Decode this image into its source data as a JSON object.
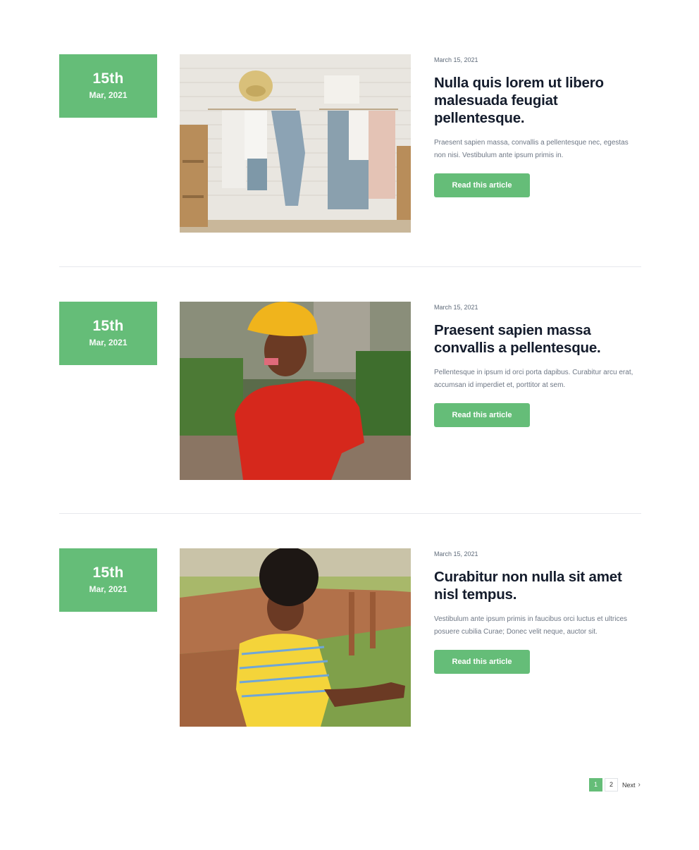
{
  "posts": [
    {
      "date_day": "15th",
      "date_month": "Mar, 2021",
      "meta_date": "March 15, 2021",
      "title": "Nulla quis lorem ut libero malesuada feugiat pellentesque.",
      "excerpt": "Praesent sapien massa, convallis a pellentesque nec, egestas non nisi. Vestibulum ante ipsum primis in.",
      "button_label": "Read this article",
      "image": "clothes-rack-photo"
    },
    {
      "date_day": "15th",
      "date_month": "Mar, 2021",
      "meta_date": "March 15, 2021",
      "title": "Praesent sapien massa convallis a pellentesque.",
      "excerpt": "Pellentesque in ipsum id orci porta dapibus. Curabitur arcu erat, accumsan id imperdiet et, porttitor at sem.",
      "button_label": "Read this article",
      "image": "woman-yellow-beanie-photo"
    },
    {
      "date_day": "15th",
      "date_month": "Mar, 2021",
      "meta_date": "March 15, 2021",
      "title": "Curabitur non nulla sit amet nisl tempus.",
      "excerpt": "Vestibulum ante ipsum primis in faucibus orci luctus et ultrices posuere cubilia Curae; Donec velit neque, auctor sit.",
      "button_label": "Read this article",
      "image": "woman-striped-shirt-photo"
    }
  ],
  "pagination": {
    "pages": [
      "1",
      "2"
    ],
    "current": "1",
    "next_label": "Next",
    "next_icon": "chevron-right-icon"
  },
  "colors": {
    "accent": "#65bd78",
    "title": "#141c2c",
    "body_text": "#6e7785",
    "divider": "#e6e8ec"
  }
}
